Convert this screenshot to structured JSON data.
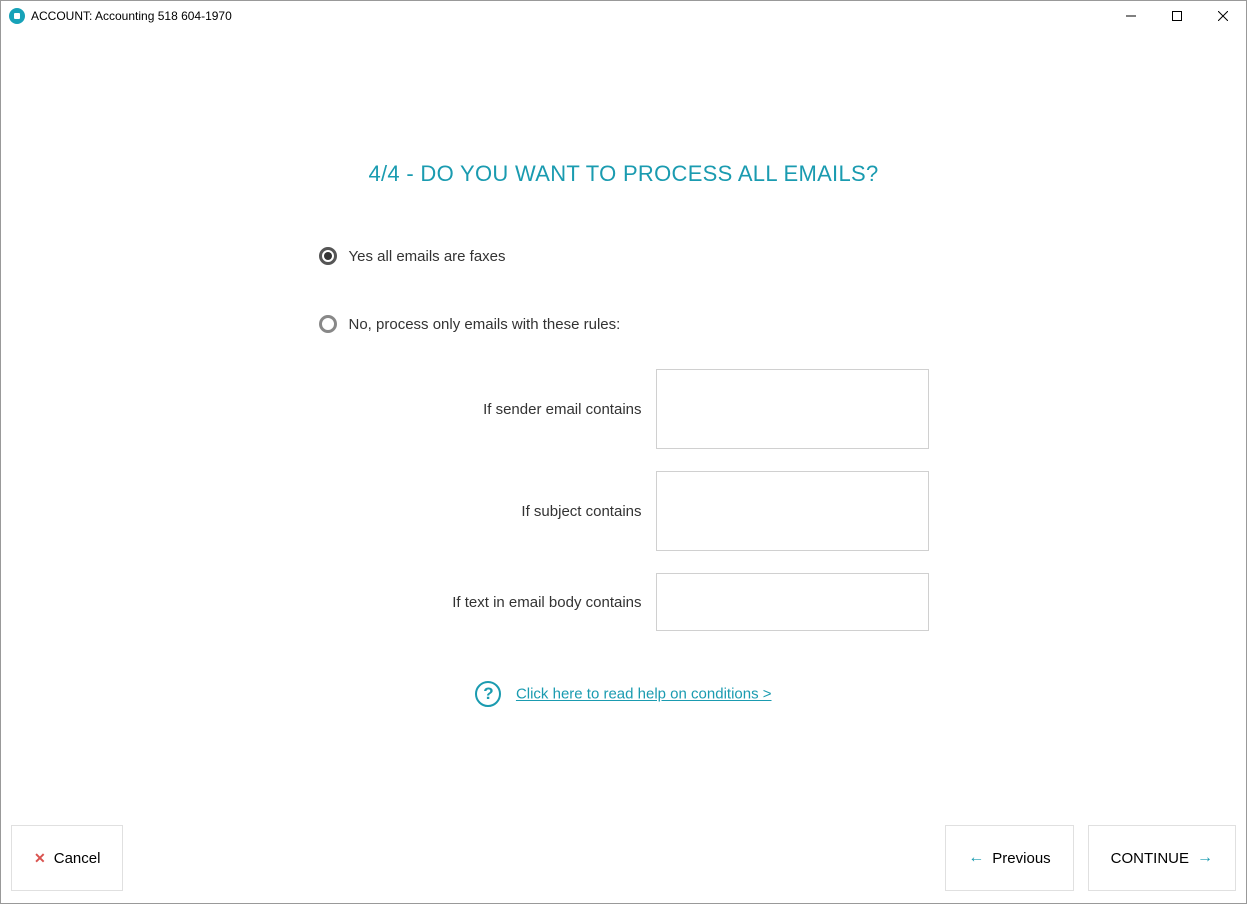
{
  "window": {
    "title": "ACCOUNT: Accounting 518 604-1970"
  },
  "heading": "4/4 - DO YOU WANT TO PROCESS ALL EMAILS?",
  "radios": {
    "yes": "Yes all emails are faxes",
    "no": "No, process only emails with these rules:"
  },
  "rules": {
    "sender_label": "If sender email contains",
    "sender_value": "",
    "subject_label": "If subject contains",
    "subject_value": "",
    "body_label": "If text in email body contains",
    "body_value": ""
  },
  "help": {
    "link": "Click here to read help on conditions >"
  },
  "buttons": {
    "cancel": "Cancel",
    "previous": "Previous",
    "continue": "CONTINUE"
  }
}
